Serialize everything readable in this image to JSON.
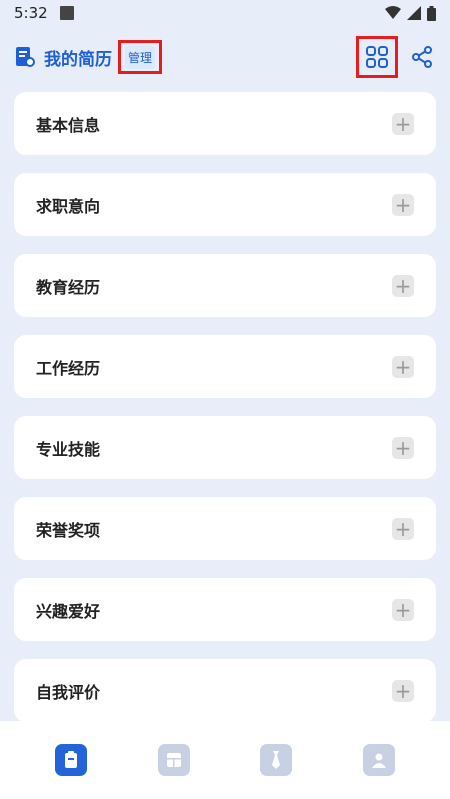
{
  "status_bar": {
    "time": "5:32"
  },
  "header": {
    "title": "我的简历",
    "manage_label": "管理",
    "icons": [
      "resume-icon",
      "grid-icon",
      "share-icon"
    ]
  },
  "sections": [
    {
      "label": "基本信息"
    },
    {
      "label": "求职意向"
    },
    {
      "label": "教育经历"
    },
    {
      "label": "工作经历"
    },
    {
      "label": "专业技能"
    },
    {
      "label": "荣誉奖项"
    },
    {
      "label": "兴趣爱好"
    },
    {
      "label": "自我评价"
    }
  ],
  "add_icon": "+",
  "bottom_nav": [
    {
      "icon": "resume-tab-icon",
      "active": true
    },
    {
      "icon": "template-tab-icon",
      "active": false
    },
    {
      "icon": "tie-tab-icon",
      "active": false
    },
    {
      "icon": "profile-tab-icon",
      "active": false
    }
  ],
  "colors": {
    "accent": "#2463d8",
    "highlight": "#e41e1e",
    "background": "#e8eef9"
  }
}
